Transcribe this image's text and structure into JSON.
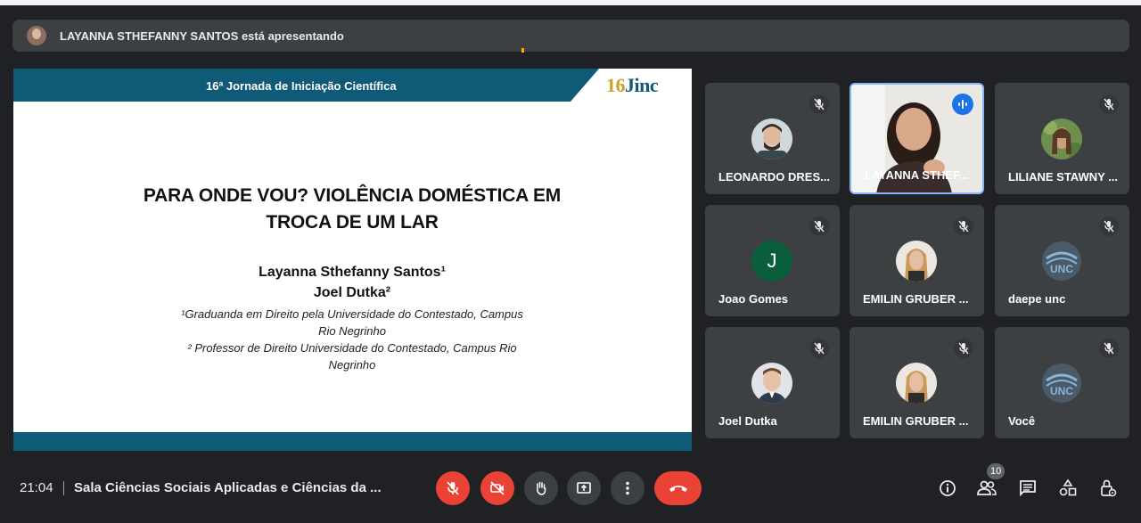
{
  "presenter_banner": {
    "text": "LAYANNA STHEFANNY SANTOS está apresentando"
  },
  "slide": {
    "header": "16ª Jornada de Iniciação Científica",
    "logo_number": "16",
    "logo_text": "Jinc",
    "title_line1": "PARA ONDE VOU? VIOLÊNCIA DOMÉSTICA EM",
    "title_line2": "TROCA DE UM LAR",
    "author1": "Layanna Sthefanny Santos¹",
    "author2": "Joel Dutka²",
    "affiliation1_line1": "¹Graduanda em Direito pela Universidade do Contestado, Campus",
    "affiliation1_line2": "Rio Negrinho",
    "affiliation2_line1": "² Professor de Direito Universidade do Contestado, Campus Rio",
    "affiliation2_line2": "Negrinho"
  },
  "participants": [
    {
      "name": "LEONARDO DRES...",
      "muted": true,
      "avatar": "photo"
    },
    {
      "name": "LAYANNA STHEF...",
      "muted": false,
      "avatar": "video",
      "speaking": true
    },
    {
      "name": "LILIANE STAWNY ...",
      "muted": true,
      "avatar": "photo"
    },
    {
      "name": "Joao Gomes",
      "muted": true,
      "avatar": "initial",
      "initial": "J"
    },
    {
      "name": "EMILIN GRUBER ...",
      "muted": true,
      "avatar": "photo"
    },
    {
      "name": "daepe unc",
      "muted": true,
      "avatar": "unc-logo",
      "logo_text": "UNC"
    },
    {
      "name": "Joel Dutka",
      "muted": true,
      "avatar": "photo"
    },
    {
      "name": "EMILIN GRUBER ...",
      "muted": true,
      "avatar": "photo"
    },
    {
      "name": "Você",
      "muted": true,
      "avatar": "unc-logo",
      "logo_text": "UNC"
    }
  ],
  "bottom_bar": {
    "time": "21:04",
    "meeting_name": "Sala Ciências Sociais Aplicadas e Ciências da ...",
    "participant_count": "10"
  },
  "controls": [
    "mic-off-icon",
    "camera-off-icon",
    "raise-hand-icon",
    "present-screen-icon",
    "more-options-icon",
    "hang-up-icon"
  ],
  "right_controls": [
    "info-icon",
    "people-icon",
    "chat-icon",
    "activities-icon",
    "host-controls-icon"
  ],
  "colors": {
    "accent_red": "#ea4335",
    "slide_blue": "#0f5a77",
    "tile_bg": "#3c4043",
    "active_border": "#8ab4f8"
  }
}
